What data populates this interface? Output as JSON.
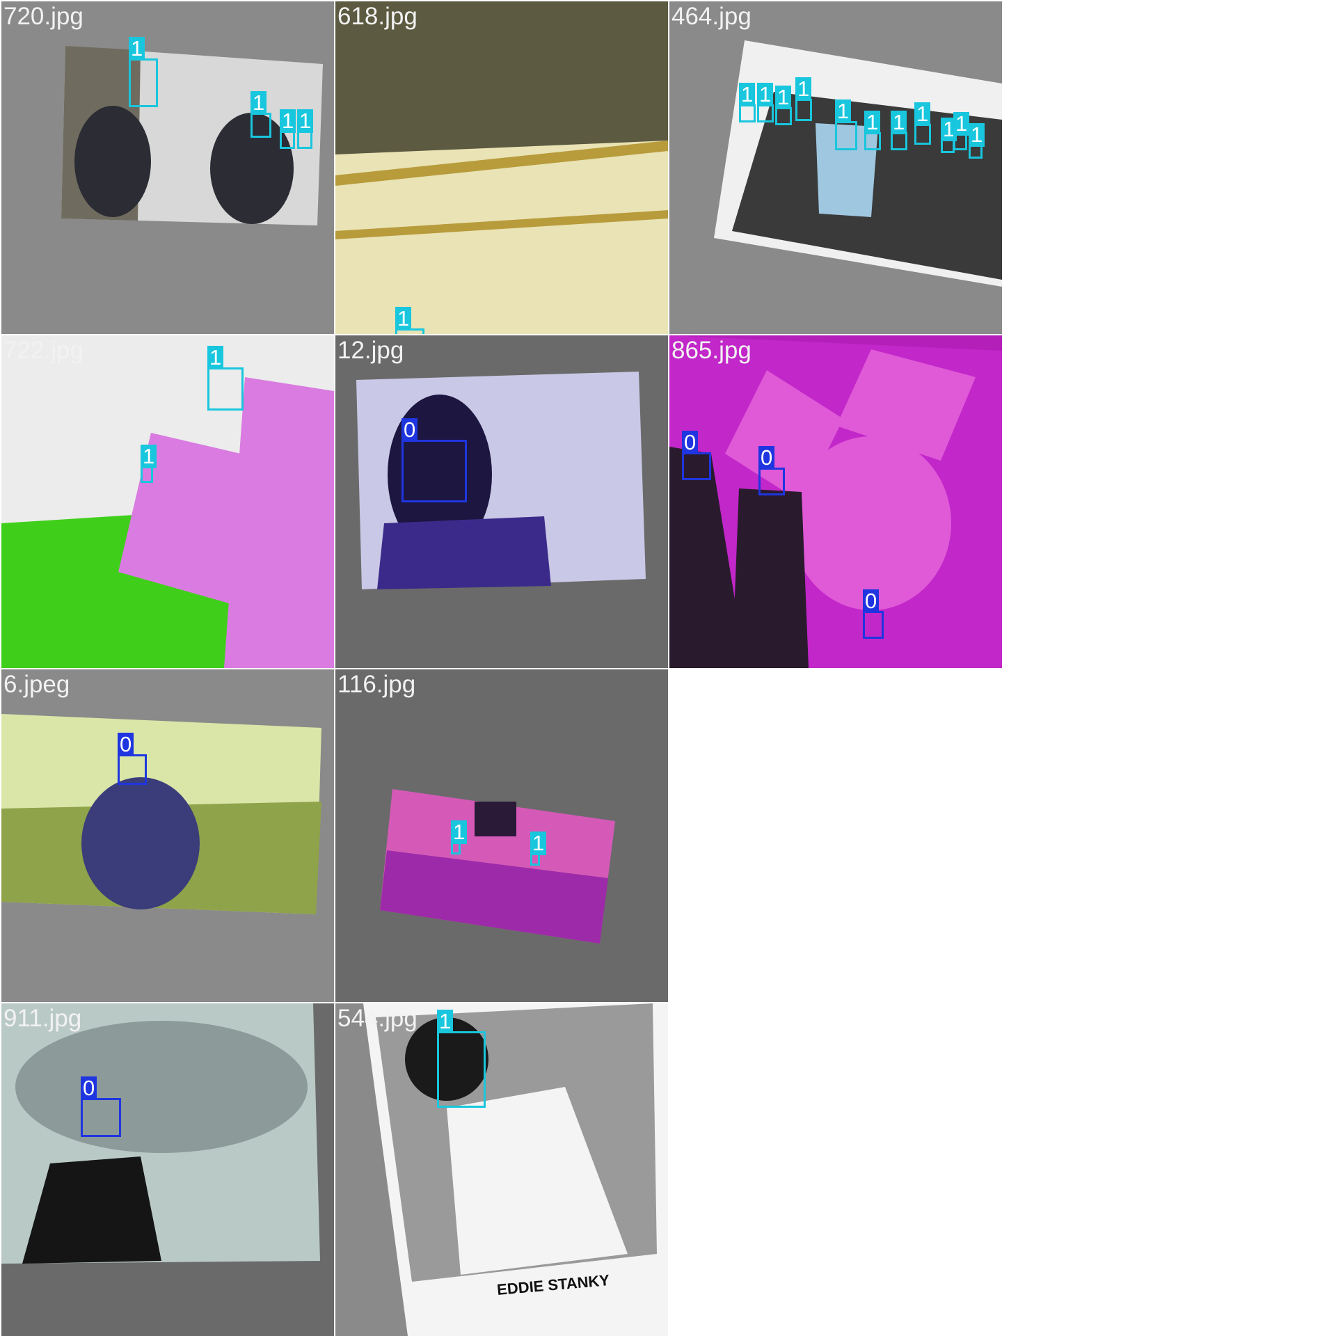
{
  "palette": {
    "class_0": "#1e35e0",
    "class_1": "#18c6dd",
    "label_text": "#ffffff",
    "filename_text": "#f2f2f2",
    "tile_gray": "#888888",
    "tile_gray_dark": "#6a6a6a",
    "page_bg": "#ffffff"
  },
  "tiles": [
    {
      "filename": "720.jpg",
      "bg": "#8a8a8a",
      "photo_colors": [
        "#d8d8d8",
        "#6f6b5e",
        "#2c2c34"
      ],
      "detections": [
        {
          "cls": "1"
        },
        {
          "cls": "1"
        },
        {
          "cls": "1"
        },
        {
          "cls": "1"
        }
      ]
    },
    {
      "filename": "618.jpg",
      "bg": "#8a8a8a",
      "photo_colors": [
        "#e9e3b5",
        "#b89b3b",
        "#5c5a40"
      ],
      "detections": [
        {
          "cls": "1"
        }
      ]
    },
    {
      "filename": "464.jpg",
      "bg": "#8a8a8a",
      "photo_colors": [
        "#f0f0f0",
        "#9fc7e0",
        "#3a3a3a"
      ],
      "detections": [
        {
          "cls": "1"
        },
        {
          "cls": "1"
        },
        {
          "cls": "1"
        },
        {
          "cls": "1"
        },
        {
          "cls": "1"
        },
        {
          "cls": "1"
        },
        {
          "cls": "1"
        },
        {
          "cls": "1"
        },
        {
          "cls": "1"
        },
        {
          "cls": "1"
        },
        {
          "cls": "1"
        }
      ]
    },
    {
      "filename": "722.jpg",
      "bg": "#e8e8e8",
      "photo_colors": [
        "#ececec",
        "#3fcf1a",
        "#d97be0"
      ],
      "detections": [
        {
          "cls": "1"
        },
        {
          "cls": "1"
        }
      ]
    },
    {
      "filename": "12.jpg",
      "bg": "#6a6a6a",
      "photo_colors": [
        "#c9c8e6",
        "#3c2a8a",
        "#1c1640"
      ],
      "detections": [
        {
          "cls": "0"
        }
      ]
    },
    {
      "filename": "865.jpg",
      "bg": "#b31fb8",
      "photo_colors": [
        "#c227c9",
        "#e05ad8",
        "#2a1a2e"
      ],
      "detections": [
        {
          "cls": "0"
        },
        {
          "cls": "0"
        },
        {
          "cls": "0"
        }
      ]
    },
    {
      "filename": "6.jpeg",
      "bg": "#8a8a8a",
      "photo_colors": [
        "#d9e6a8",
        "#8ea34a",
        "#3b3d7a"
      ],
      "detections": [
        {
          "cls": "0"
        }
      ]
    },
    {
      "filename": "116.jpg",
      "bg": "#6a6a6a",
      "photo_colors": [
        "#d55ab8",
        "#9d2aa8",
        "#2a1a38"
      ],
      "detections": [
        {
          "cls": "1"
        },
        {
          "cls": "1"
        }
      ]
    },
    {
      "filename": "911.jpg",
      "bg": "#6a6a6a",
      "photo_colors": [
        "#b9c9c6",
        "#8c9a9a",
        "#151515"
      ],
      "detections": [
        {
          "cls": "0"
        }
      ]
    },
    {
      "filename": "544.jpg",
      "bg": "#8a8a8a",
      "photo_colors": [
        "#f4f4f4",
        "#9a9a9a",
        "#1a1a1a"
      ],
      "card_caption": "EDDIE STANKY",
      "detections": [
        {
          "cls": "1"
        }
      ]
    }
  ]
}
